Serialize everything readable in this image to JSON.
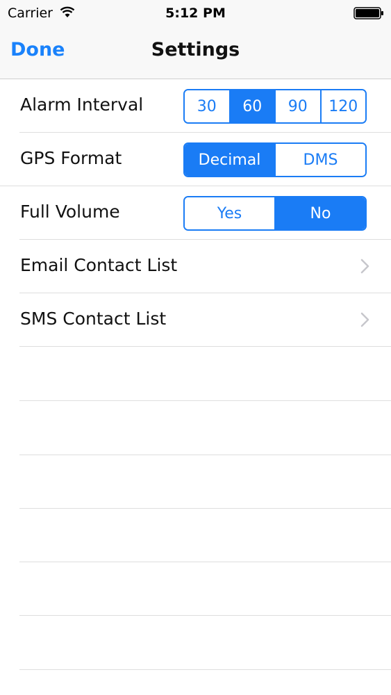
{
  "status_bar": {
    "carrier": "Carrier",
    "time": "5:12 PM",
    "icons": [
      "wifi-icon",
      "battery-icon"
    ]
  },
  "nav": {
    "done_label": "Done",
    "title": "Settings"
  },
  "settings": {
    "alarm_interval": {
      "label": "Alarm Interval",
      "options": [
        "30",
        "60",
        "90",
        "120"
      ],
      "selected": "60"
    },
    "gps_format": {
      "label": "GPS Format",
      "options": [
        "Decimal",
        "DMS"
      ],
      "selected": "Decimal"
    },
    "full_volume": {
      "label": "Full Volume",
      "options": [
        "Yes",
        "No"
      ],
      "selected": "No"
    },
    "email_contact_list": {
      "label": "Email Contact List"
    },
    "sms_contact_list": {
      "label": "SMS Contact List"
    }
  },
  "colors": {
    "accent": "#1a7cf5",
    "bar_background": "#f8f8f8",
    "separator": "#dedede"
  }
}
